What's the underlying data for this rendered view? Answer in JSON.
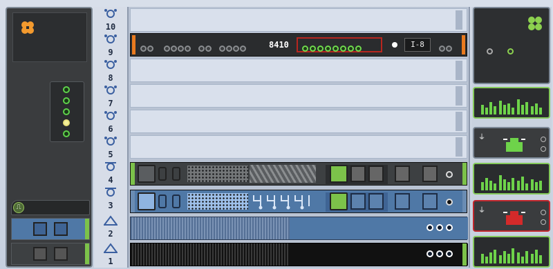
{
  "colors": {
    "accent_orange": "#e97a1f",
    "led_green": "#5fd34b",
    "led_yellow": "#f3ef9a",
    "alarm_red": "#c1272d",
    "panel_dark": "#3a3c3e",
    "rack_blue": "#4f78a6"
  },
  "left_panel": {
    "logo_icon": "orange-logo-icon",
    "leds": [
      "green",
      "green",
      "green",
      "yellow",
      "green"
    ],
    "badge_icon": "pulse-icon",
    "badge_glyph": "⎍"
  },
  "rack": {
    "slot_numbers": [
      "10",
      "9",
      "8",
      "7",
      "6",
      "5",
      "4",
      "3",
      "2",
      "1"
    ],
    "device_9": {
      "model": "8410",
      "io_label": "I-8"
    }
  },
  "right_panel": {
    "logo_icon": "green-logo-icon"
  }
}
